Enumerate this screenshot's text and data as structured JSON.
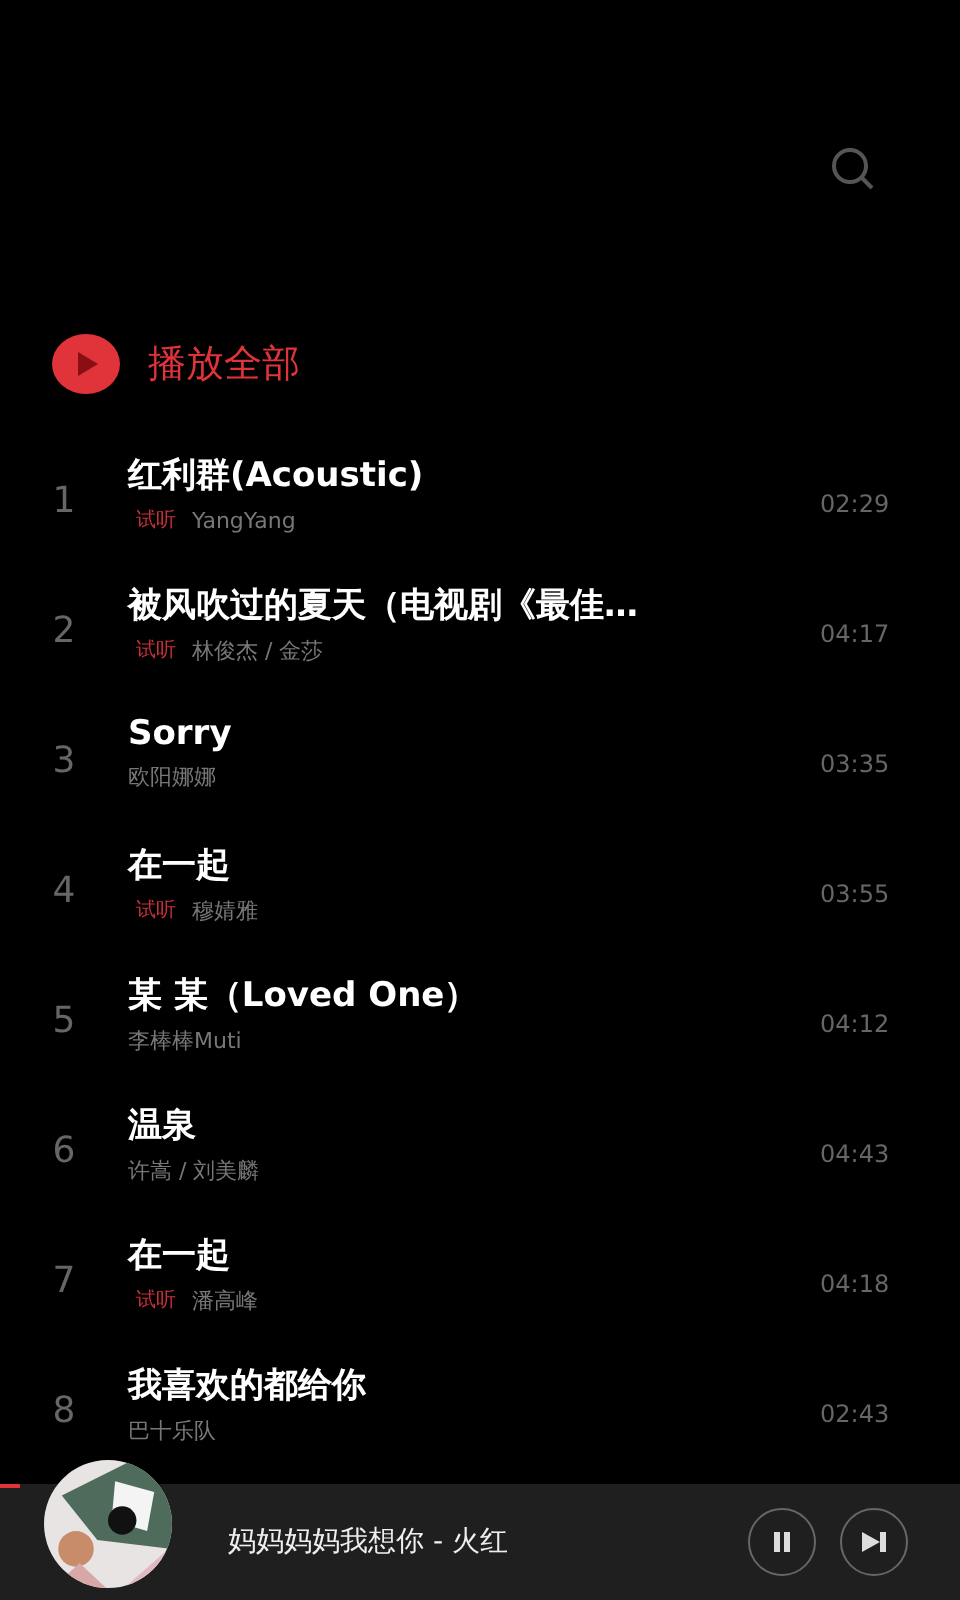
{
  "play_all": {
    "label": "播放全部"
  },
  "songs": [
    {
      "number": "1",
      "title": "红利群(Acoustic)",
      "preview": true,
      "preview_label": "试听",
      "artist": "YangYang",
      "duration": "02:29"
    },
    {
      "number": "2",
      "title": "被风吹过的夏天（电视剧《最佳…",
      "preview": true,
      "preview_label": "试听",
      "artist": "林俊杰 / 金莎",
      "duration": "04:17"
    },
    {
      "number": "3",
      "title": "Sorry",
      "preview": false,
      "artist": "欧阳娜娜",
      "duration": "03:35"
    },
    {
      "number": "4",
      "title": "在一起",
      "preview": true,
      "preview_label": "试听",
      "artist": "穆婧雅",
      "duration": "03:55"
    },
    {
      "number": "5",
      "title": "某 某（Loved One）",
      "preview": false,
      "artist": "李棒棒Muti",
      "duration": "04:12"
    },
    {
      "number": "6",
      "title": "温泉",
      "preview": false,
      "artist": "许嵩 / 刘美麟",
      "duration": "04:43"
    },
    {
      "number": "7",
      "title": "在一起",
      "preview": true,
      "preview_label": "试听",
      "artist": "潘高峰",
      "duration": "04:18"
    },
    {
      "number": "8",
      "title": "我喜欢的都给你",
      "preview": false,
      "artist": "巴十乐队",
      "duration": "02:43"
    }
  ],
  "player": {
    "title": "妈妈妈妈我想你",
    "separator": "-",
    "artist": "火红",
    "level": 0.02,
    "playing": true
  }
}
